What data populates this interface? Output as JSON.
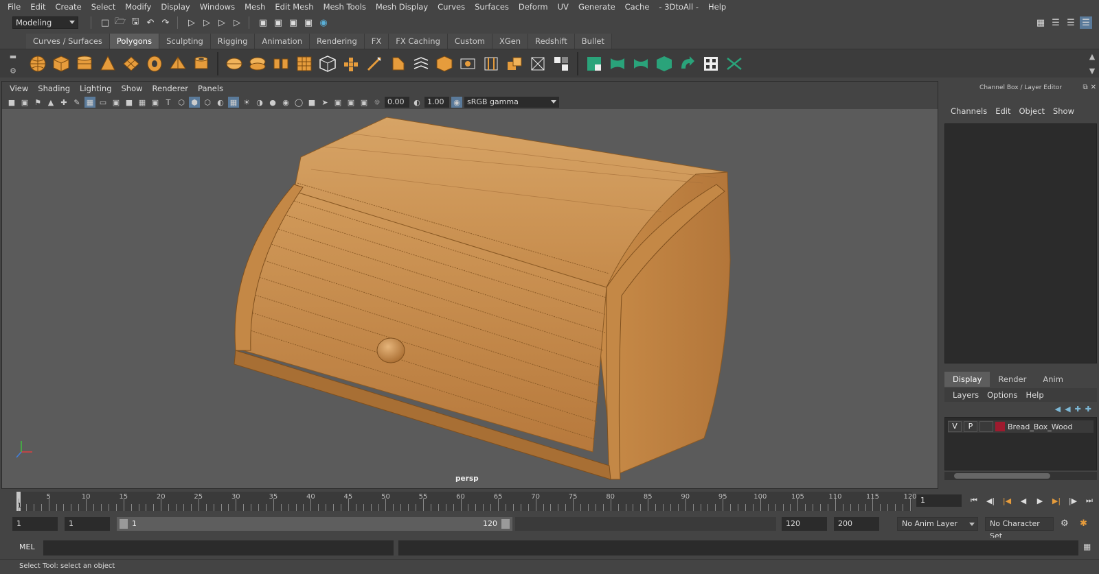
{
  "menubar": [
    "File",
    "Edit",
    "Create",
    "Select",
    "Modify",
    "Display",
    "Windows",
    "Mesh",
    "Edit Mesh",
    "Mesh Tools",
    "Mesh Display",
    "Curves",
    "Surfaces",
    "Deform",
    "UV",
    "Generate",
    "Cache",
    "- 3DtoAll -",
    "Help"
  ],
  "statusline": {
    "mode": "Modeling"
  },
  "shelf": {
    "tabs": [
      "Curves / Surfaces",
      "Polygons",
      "Sculpting",
      "Rigging",
      "Animation",
      "Rendering",
      "FX",
      "FX Caching",
      "Custom",
      "XGen",
      "Redshift",
      "Bullet"
    ],
    "active_tab": "Polygons"
  },
  "viewport": {
    "menu": [
      "View",
      "Shading",
      "Lighting",
      "Show",
      "Renderer",
      "Panels"
    ],
    "exposure": "0.00",
    "gamma": "1.00",
    "color_space": "sRGB gamma",
    "camera": "persp"
  },
  "channel_box": {
    "title": "Channel Box / Layer Editor",
    "menu": [
      "Channels",
      "Edit",
      "Object",
      "Show"
    ]
  },
  "layer_editor": {
    "tabs": [
      "Display",
      "Render",
      "Anim"
    ],
    "active_tab": "Display",
    "menu": [
      "Layers",
      "Options",
      "Help"
    ],
    "layers": [
      {
        "visible": "V",
        "playback": "P",
        "name": "Bread_Box_Wood",
        "color": "#9e1a2e"
      }
    ]
  },
  "time_slider": {
    "ticks": [
      1,
      5,
      10,
      15,
      20,
      25,
      30,
      35,
      40,
      45,
      50,
      55,
      60,
      65,
      70,
      75,
      80,
      85,
      90,
      95,
      100,
      105,
      110,
      115,
      120
    ],
    "current": "1",
    "current_frame": "1"
  },
  "range_slider": {
    "start": "1",
    "playback_start": "1",
    "range_start_label": "1",
    "range_end_label": "120",
    "playback_end": "120",
    "end": "200",
    "anim_layer": "No Anim Layer",
    "character_set": "No Character Set"
  },
  "command_line": {
    "label": "MEL"
  },
  "help_line": "Select Tool: select an object"
}
